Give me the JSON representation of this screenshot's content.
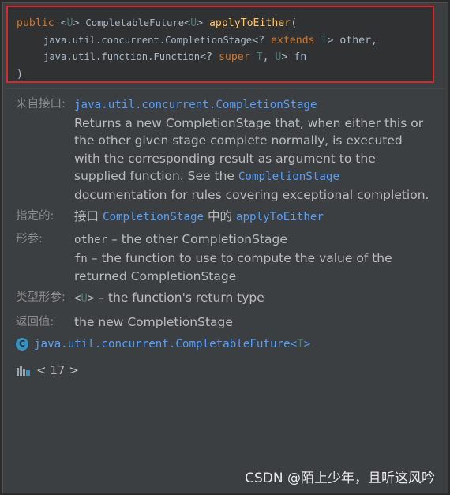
{
  "signature": {
    "public": "public",
    "lt1": "<",
    "U1": "U",
    "gt1": ">",
    "return_type": "CompletableFuture",
    "lt2": "<",
    "U2": "U",
    "gt2": ">",
    "method": "applyToEither",
    "open_paren": "(",
    "line2_type": "java.util.concurrent.CompletionStage",
    "line2_wild": "<?",
    "extends": "extends",
    "T1": "T",
    "line2_tail": "> other,",
    "line3_type": "java.util.function.Function",
    "line3_wild": "<?",
    "super": "super",
    "T2": "T",
    "comma": ",",
    "U3": "U",
    "line3_tail": "> fn",
    "close_paren": ")"
  },
  "doc": {
    "from_interface_label": "来自接口:",
    "from_interface_link": "java.util.concurrent.CompletionStage",
    "desc_1": "Returns a new CompletionStage that, when either this or",
    "desc_2": "the other given stage complete normally, is executed",
    "desc_3": "with the corresponding result as argument to the",
    "desc_4a": "supplied function. See the ",
    "desc_4_link": "CompletionStage",
    "desc_5": "documentation for rules covering exceptional completion.",
    "specified_label": "指定的:",
    "specified_prefix": "接口 ",
    "specified_link1": "CompletionStage",
    "specified_mid": " 中的 ",
    "specified_link2": "applyToEither",
    "params_label": "形参:",
    "param1_name": "other",
    "param1_desc": " – the other CompletionStage",
    "param2_name": "fn",
    "param2_desc": " – the function to use to compute the value of the",
    "param2_desc2": "returned CompletionStage",
    "type_params_label": "类型形参:",
    "tp_lt": "<",
    "tp_U": "U",
    "tp_gt": ">",
    "tp_desc": " – the function's return type",
    "returns_label": "返回值:",
    "returns_value": "the new CompletionStage",
    "class_icon_letter": "C",
    "class_link": "java.util.concurrent.CompletableFuture",
    "class_lt": "<",
    "class_T": "T",
    "class_gt": ">",
    "jdk_label": "< 17 >"
  },
  "watermark": "CSDN @陌上少年，且听这风吟",
  "colors": {
    "background": "#3c3f41",
    "keyword": "#cc7832",
    "type_param": "#507874",
    "method": "#ffc66d",
    "link": "#589df6",
    "highlight_border": "#e0242c"
  }
}
